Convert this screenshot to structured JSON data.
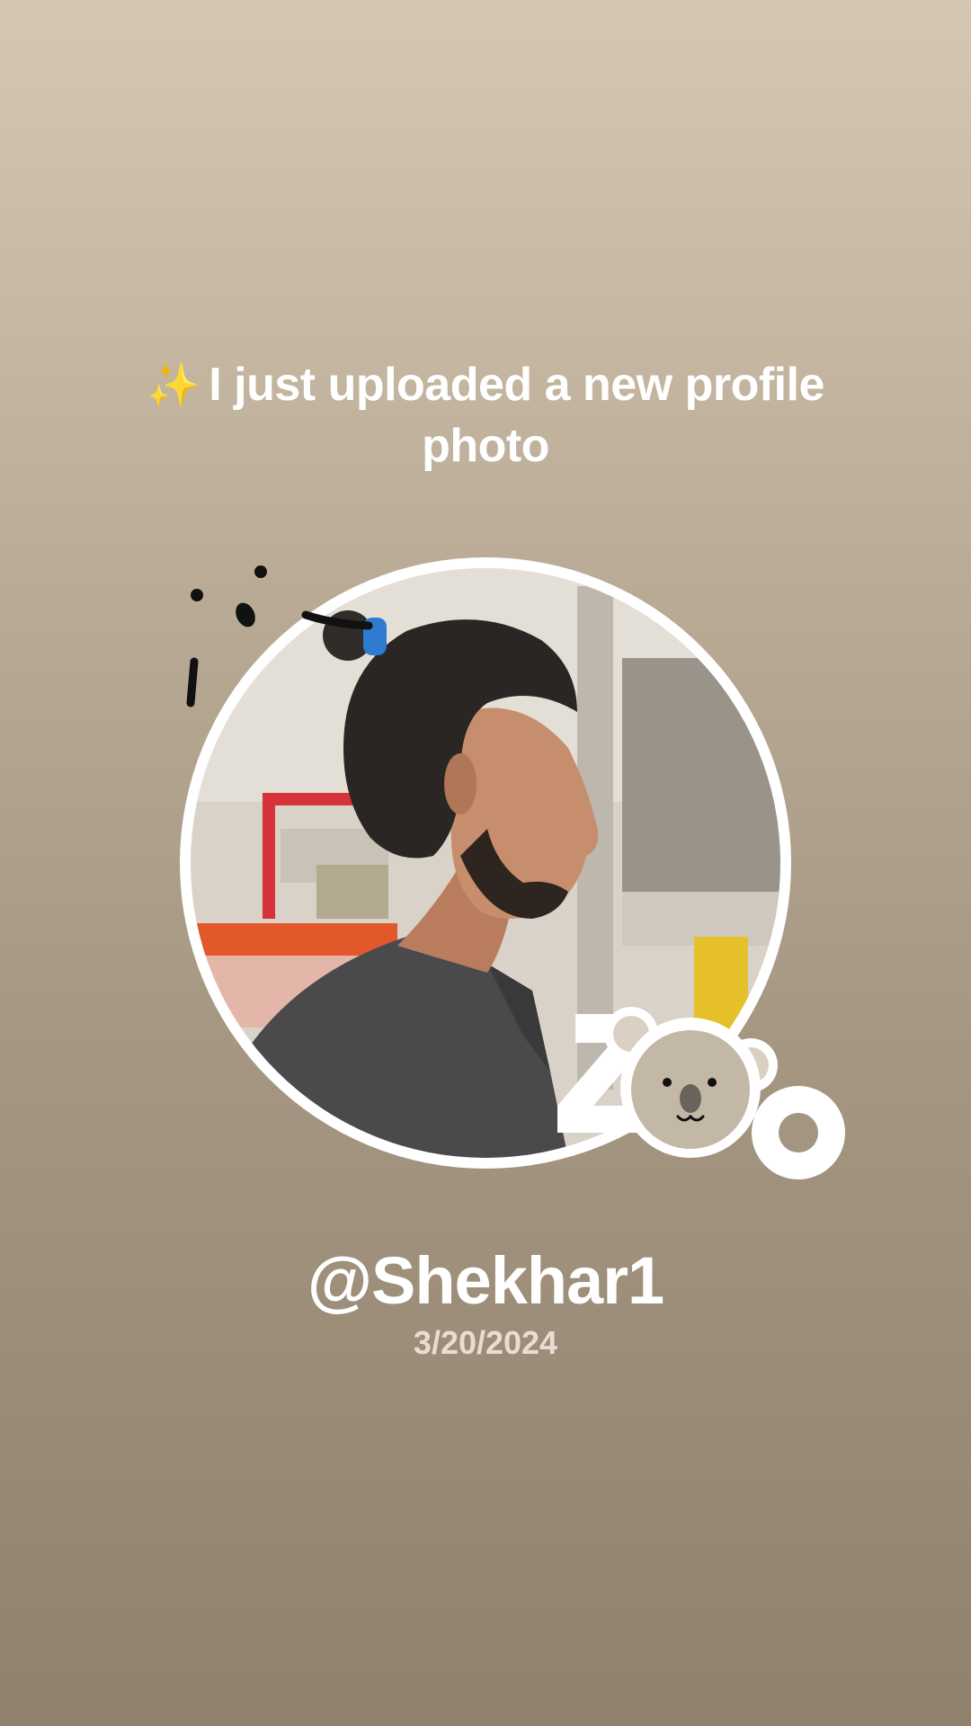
{
  "story": {
    "sparkle_emoji": "✨",
    "headline": "I just uploaded a new profile photo",
    "username": "@Shekhar1",
    "date": "3/20/2024"
  },
  "photo": {
    "icon": "profile-photo",
    "ring_color": "#ffffff"
  },
  "stickers": {
    "doodle_icon": "sweat-drops-doodle-icon",
    "zoo_sticker_icon": "zoo-koala-sticker-icon",
    "zoo_text": "ZOO"
  },
  "colors": {
    "background_top": "#d5c7b2",
    "background_bottom": "#8f816c",
    "text": "#ffffff",
    "date_text": "#e7ded1"
  }
}
